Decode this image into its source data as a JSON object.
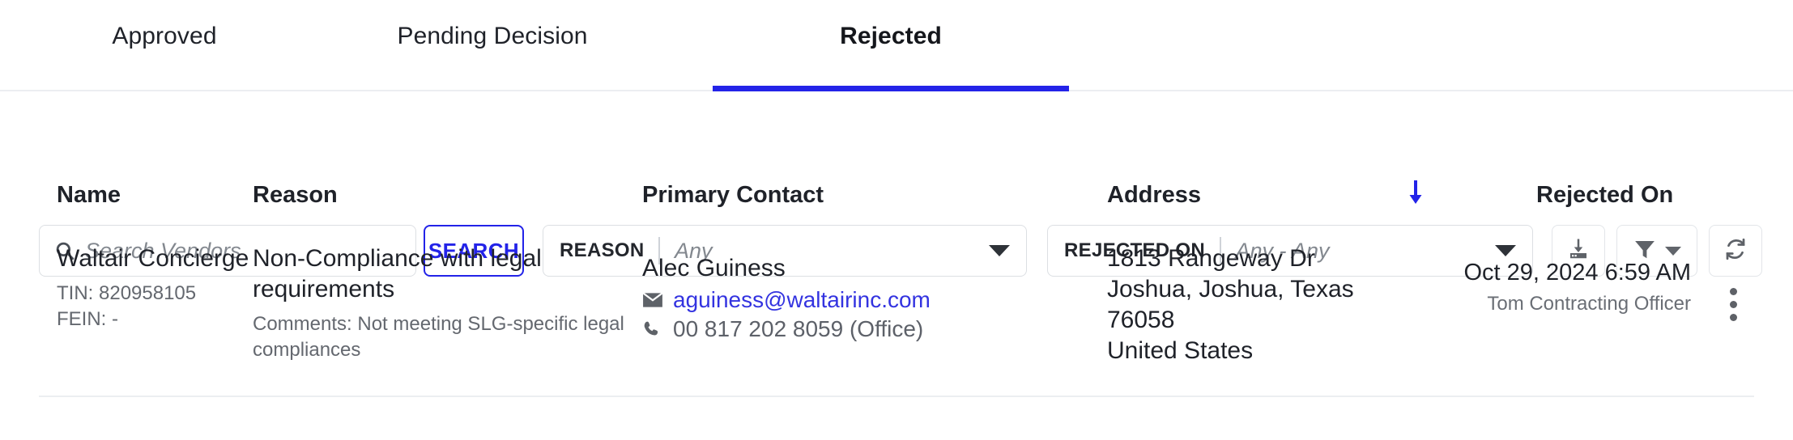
{
  "tabs": [
    {
      "id": "approved",
      "label": "Approved",
      "active": false
    },
    {
      "id": "pending",
      "label": "Pending Decision",
      "active": false
    },
    {
      "id": "rejected",
      "label": "Rejected",
      "active": true
    }
  ],
  "toolbar": {
    "search_placeholder": "Search Vendors",
    "search_value": "",
    "search_button": "SEARCH",
    "reason_filter": {
      "label": "REASON",
      "value": "Any"
    },
    "rejected_on_filter": {
      "label": "REJECTED ON",
      "value": "Any - Any"
    },
    "icons": {
      "search": "search-icon",
      "export": "download-icon",
      "filter": "filter-icon",
      "refresh": "refresh-icon"
    }
  },
  "table": {
    "headers": {
      "name": "Name",
      "reason": "Reason",
      "primary_contact": "Primary Contact",
      "address": "Address",
      "rejected_on": "Rejected On"
    },
    "sort": {
      "column": "address",
      "direction": "desc",
      "icon": "arrow-down-icon"
    },
    "rows": [
      {
        "name": "Waltair Concierge",
        "tin": "TIN: 820958105",
        "fein": "FEIN: -",
        "reason": "Non-Compliance with legal requirements",
        "comments": "Comments: Not meeting SLG-specific legal compliances",
        "contact_name": "Alec Guiness",
        "contact_email": "aguiness@waltairinc.com",
        "contact_phone": "00 817 202 8059 (Office)",
        "address_line1": "1813 Rangeway Dr",
        "address_line2": "Joshua, Joshua, Texas",
        "address_line3": "76058",
        "address_line4": "United States",
        "rejected_on": "Oct 29, 2024 6:59 AM",
        "rejected_by": "Tom Contracting Officer"
      }
    ]
  },
  "colors": {
    "accent": "#2323e8",
    "link": "#3333e0",
    "text": "#1f2229",
    "muted": "#64686f",
    "border": "#eceef1"
  }
}
